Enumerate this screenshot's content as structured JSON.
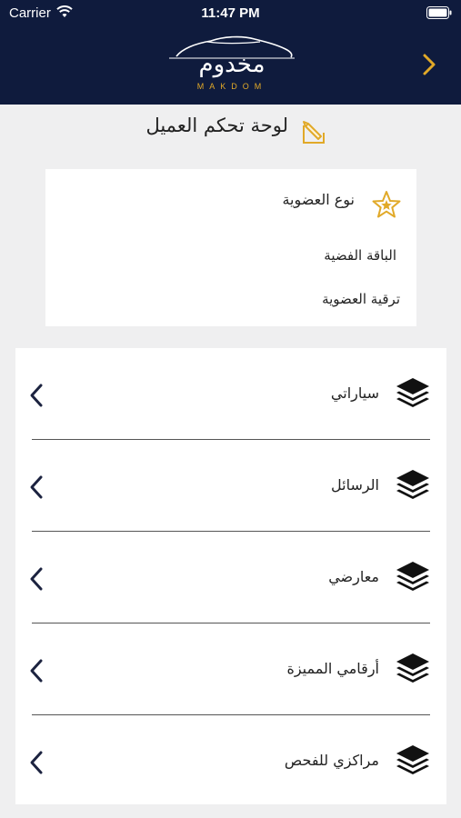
{
  "status_bar": {
    "carrier": "Carrier",
    "time": "11:47 PM"
  },
  "header": {
    "logo_arabic": "مخدوم",
    "logo_latin": "MAKDOM",
    "background_color": "#0f1b3d",
    "accent_color": "#e1a928",
    "forward_icon": "chevron-right-icon"
  },
  "page": {
    "title": "لوحة تحكم العميل",
    "title_icon": "edit-icon"
  },
  "membership": {
    "title": "نوع العضوية",
    "icon": "star-icon",
    "plan": "الباقة الفضية",
    "upgrade_label": "ترقية العضوية"
  },
  "menu": {
    "items": [
      {
        "label": "سياراتي",
        "icon": "layers-icon"
      },
      {
        "label": "الرسائل",
        "icon": "layers-icon"
      },
      {
        "label": "معارضي",
        "icon": "layers-icon"
      },
      {
        "label": "أرقامي المميزة",
        "icon": "layers-icon"
      },
      {
        "label": "مراكزي للفحص",
        "icon": "layers-icon"
      }
    ]
  }
}
